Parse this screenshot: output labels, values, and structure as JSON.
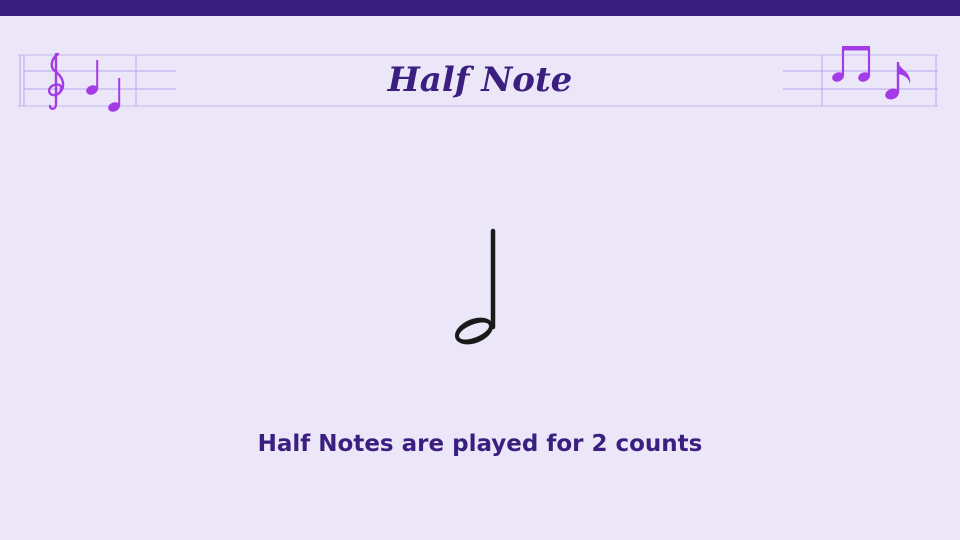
{
  "slide": {
    "title": "Half Note",
    "caption": "Half Notes are played for 2 counts"
  },
  "colors": {
    "top_bar": "#3a1f80",
    "title": "#3a1f80",
    "staff_lines": "#b8a6ee",
    "decor_notes": "#a33be6",
    "main_note": "#1a1a1a",
    "background": "#ece7f8"
  },
  "icons": {
    "left_decor": [
      "treble-clef-icon",
      "quarter-note-icon",
      "half-note-icon"
    ],
    "right_decor": [
      "beamed-eighth-notes-icon",
      "eighth-note-icon"
    ],
    "main": "half-note-icon"
  }
}
